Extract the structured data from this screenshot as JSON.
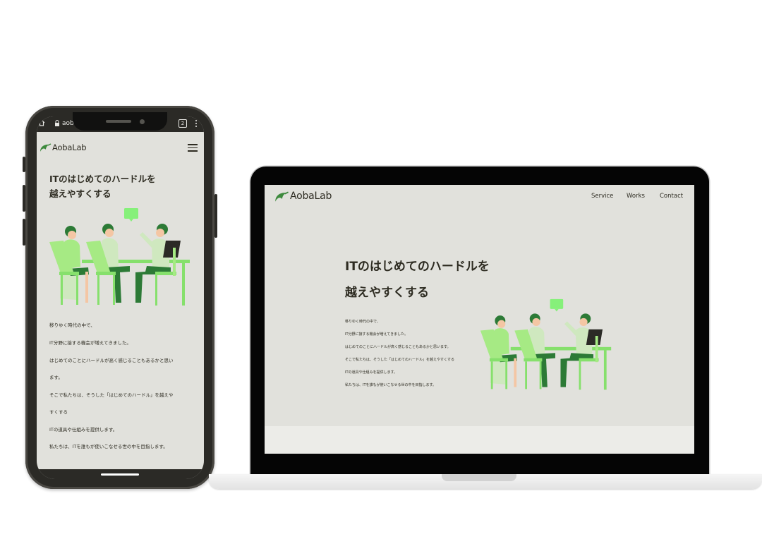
{
  "brand": {
    "name": "AobaLab",
    "colors": {
      "accent": "#3d8a3d",
      "light_green": "#a6ea84",
      "bright_green": "#86f07a",
      "dark_green": "#2c7a36",
      "screen_bg": "#e1e1dc",
      "text": "#2e2c22"
    }
  },
  "phone": {
    "statusbar": {
      "url_text": "aob",
      "tab_count": "2"
    },
    "header": {
      "menu_icon": "hamburger-menu-icon"
    },
    "hero": {
      "title_line1": "ITのはじめてのハードルを",
      "title_line2": "越えやすくする"
    },
    "copy": [
      "移りゆく時代の中で、",
      "IT分野に接する機会が増えてきました。",
      "はじめてのことにハードルが高く感じることもあるかと思い",
      "ます。",
      "そこで私たちは、そうした「はじめてのハードル」を越えや",
      "すくする",
      "ITの道具や仕組みを提供します。",
      "私たちは、ITを誰もが使いこなせる世の中を目指します。"
    ]
  },
  "laptop": {
    "nav": {
      "items": [
        "Service",
        "Works",
        "Contact"
      ]
    },
    "hero": {
      "title_line1": "ITのはじめてのハードルを",
      "title_line2": "越えやすくする"
    },
    "copy": [
      "移りゆく時代の中で、",
      "IT分野に接する機会が増えてきました。",
      "はじめてのことにハードルが高く感じることもあるかと思います。",
      "そこで私たちは、そうした「はじめてのハードル」を越えやすくする",
      "ITの道具や仕組みを提供します。",
      "私たちは、ITを誰もが使いこなせる世の中を目指します。"
    ]
  }
}
